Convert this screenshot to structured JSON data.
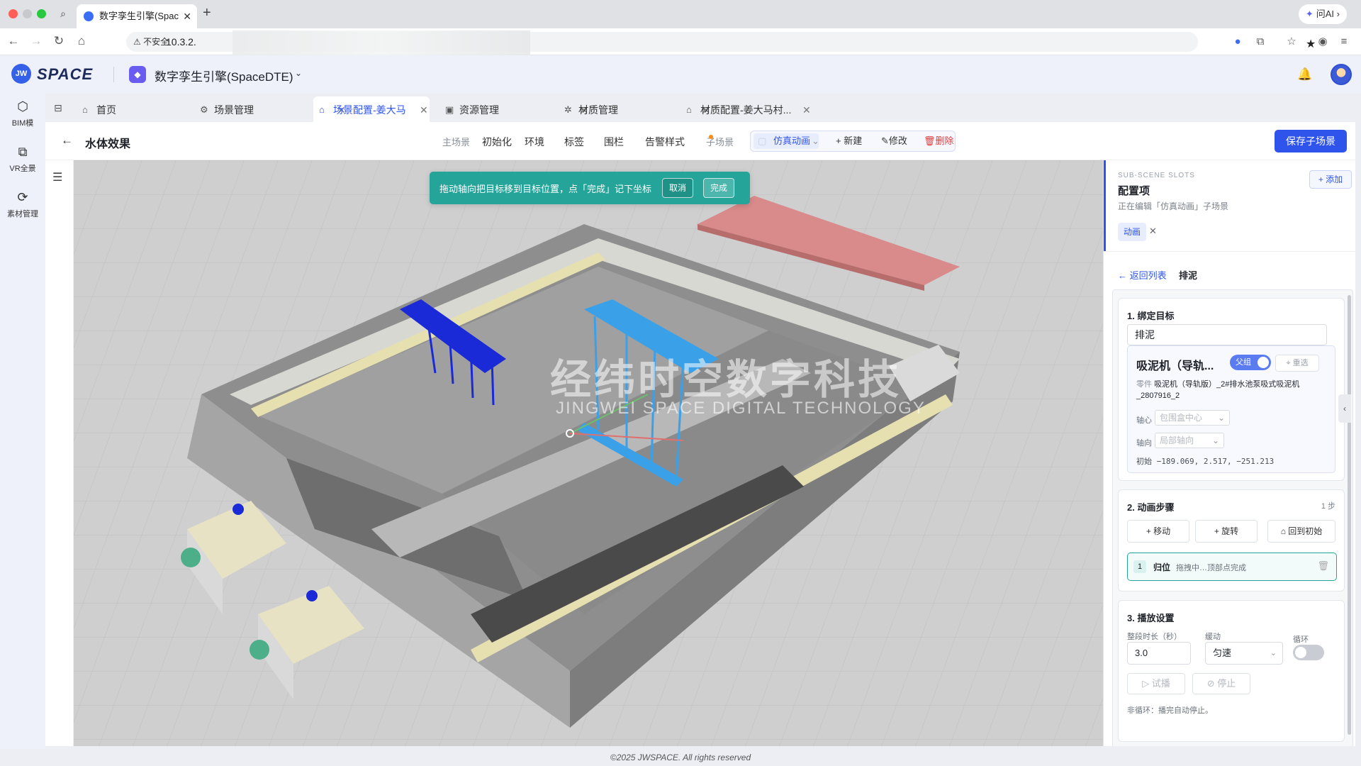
{
  "browser": {
    "tab_title": "数字孪生引擎(Spac",
    "address_warning": "不安全",
    "address_text": "10.3.2.",
    "ask_ai": "问AI"
  },
  "app": {
    "logo": "SPACE",
    "product_name": "数字孪生引擎(SpaceDTE)"
  },
  "rail": [
    {
      "label": "BIM模",
      "icon": "cube-icon"
    },
    {
      "label": "VR全景",
      "icon": "vr-icon"
    },
    {
      "label": "素材管理",
      "icon": "material-icon"
    }
  ],
  "page_tabs": [
    {
      "label": "首页",
      "icon": "home-icon",
      "closable": false
    },
    {
      "label": "场景管理",
      "icon": "gear-icon",
      "closable": true
    },
    {
      "label": "场景配置-姜大马",
      "icon": "home-icon",
      "closable": true,
      "active": true
    },
    {
      "label": "资源管理",
      "icon": "monitor-icon",
      "closable": true
    },
    {
      "label": "材质管理",
      "icon": "settings-icon",
      "closable": true
    },
    {
      "label": "材质配置-姜大马村...",
      "icon": "home-icon",
      "closable": true
    }
  ],
  "workspace": {
    "title": "水体效果",
    "main_scene_label": "主场景",
    "main_tabs": [
      "初始化",
      "环境",
      "标签",
      "围栏",
      "告警样式"
    ],
    "sub_scene_label": "子场景",
    "sub_scene_selected": "仿真动画",
    "sub_actions": {
      "new": "+ 新建",
      "edit": "修改",
      "delete": "删除"
    },
    "save_button": "保存子场景"
  },
  "viewport": {
    "hint": "拖动轴向把目标移到目标位置，点「完成」记下坐标",
    "cancel": "取消",
    "done": "完成",
    "watermark_cn": "经纬时空数字科技",
    "watermark_en": "JINGWEI SPACE DIGITAL TECHNOLOGY"
  },
  "panel": {
    "kicker": "SUB-SCENE SLOTS",
    "title": "配置项",
    "subtitle": "正在编辑「仿真动画」子场景",
    "add_button": "+ 添加",
    "tag": "动画",
    "back_link": "← 返回列表",
    "current_item": "排泥",
    "bind": {
      "title": "1. 绑定目标",
      "name_value": "排泥",
      "target_name": "吸泥机（导轨...",
      "parent_toggle": "父组",
      "reselect": "重选",
      "part_label": "零件",
      "part_value": "吸泥机（导轨版）_2#排水池泵吸式吸泥机_2807916_2",
      "pivot_label": "轴心",
      "pivot_value": "包围盒中心",
      "axis_label": "轴向",
      "axis_value": "局部轴向",
      "init_label": "初始",
      "init_value": "−189.069, 2.517, −251.213"
    },
    "steps": {
      "title": "2. 动画步骤",
      "count": "1 步",
      "move": "+ 移动",
      "rotate": "+ 旋转",
      "reset": "回到初始",
      "items": [
        {
          "num": "1",
          "name": "归位",
          "desc": "拖拽中…顶部点完成"
        }
      ]
    },
    "playback": {
      "title": "3. 播放设置",
      "duration_label": "整段时长（秒）",
      "duration_value": "3.0",
      "easing_label": "缓动",
      "easing_value": "匀速",
      "loop_label": "循环",
      "loop_on": false,
      "preview": "试播",
      "stop": "停止",
      "note": "非循环：播完自动停止。"
    }
  },
  "footer": "©2025 JWSPACE. All rights reserved",
  "colors": {
    "accent": "#2f54eb",
    "hint_bg": "#25a59a"
  }
}
